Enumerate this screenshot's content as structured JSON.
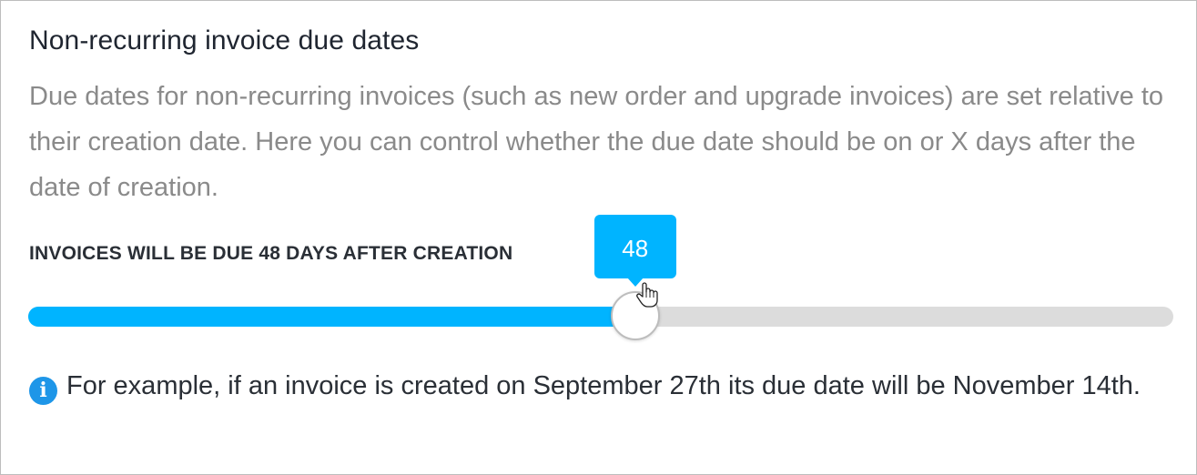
{
  "section": {
    "title": "Non-recurring invoice due dates",
    "description": "Due dates for non-recurring invoices (such as new order and upgrade invoices) are set relative to their creation date. Here you can control whether the due date should be on or X days after the date of creation."
  },
  "slider": {
    "label": "INVOICES WILL BE DUE 48 DAYS AFTER CREATION",
    "value": "48",
    "fill_fraction": 0.53,
    "accent_color": "#00b4ff",
    "track_color": "#dcdcdc"
  },
  "info": {
    "icon": "info-circle-icon",
    "icon_glyph": "i",
    "text": "For example, if an invoice is created on September 27th its due date will be November 14th."
  },
  "cursor": {
    "icon": "hand-pointer-icon"
  }
}
